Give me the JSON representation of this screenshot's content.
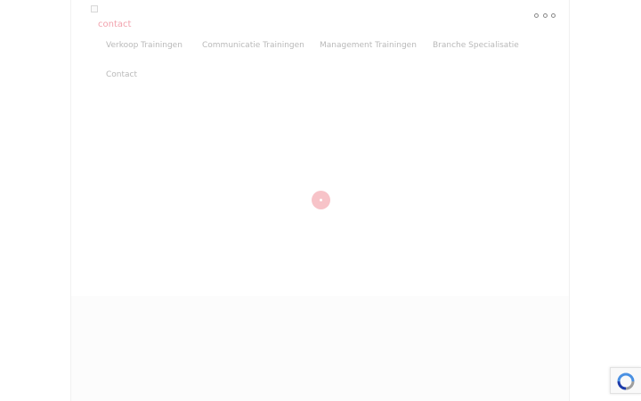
{
  "header": {
    "logo_alt": "contact",
    "menu_icon": "three-dots-icon"
  },
  "nav": {
    "items": [
      {
        "label": "Verkoop Trainingen"
      },
      {
        "label": "Communicatie Trainingen"
      },
      {
        "label": "Management Trainingen"
      },
      {
        "label": "Branche Specialisatie"
      },
      {
        "label": "Contact"
      }
    ]
  },
  "loader": {
    "icon": "loading-spinner-icon"
  },
  "recaptcha": {
    "icon": "recaptcha-icon"
  },
  "colors": {
    "accent": "#f2a2ad",
    "nav_text": "#b9b9b9",
    "spinner": "#f7c3c8"
  }
}
